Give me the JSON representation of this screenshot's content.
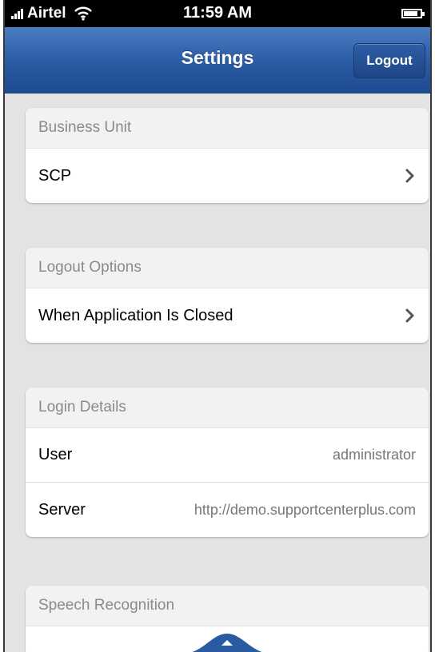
{
  "status_bar": {
    "carrier": "Airtel",
    "time": "11:59 AM",
    "battery_level": 0.85
  },
  "nav": {
    "title": "Settings",
    "logout_label": "Logout"
  },
  "sections": {
    "business_unit": {
      "header": "Business Unit",
      "value": "SCP"
    },
    "logout_options": {
      "header": "Logout Options",
      "value": "When Application Is Closed"
    },
    "login_details": {
      "header": "Login Details",
      "user_label": "User",
      "user_value": "administrator",
      "server_label": "Server",
      "server_value": "http://demo.supportcenterplus.com"
    },
    "speech_recognition": {
      "header": "Speech Recognition"
    }
  },
  "icons": {
    "signal": "signal-bars-icon",
    "wifi": "wifi-icon",
    "battery": "battery-icon",
    "chevron": "chevron-right-icon",
    "pull_tab": "chevron-up-icon"
  },
  "colors": {
    "nav_blue": "#2a5aa1",
    "background": "#e3e3e3"
  }
}
